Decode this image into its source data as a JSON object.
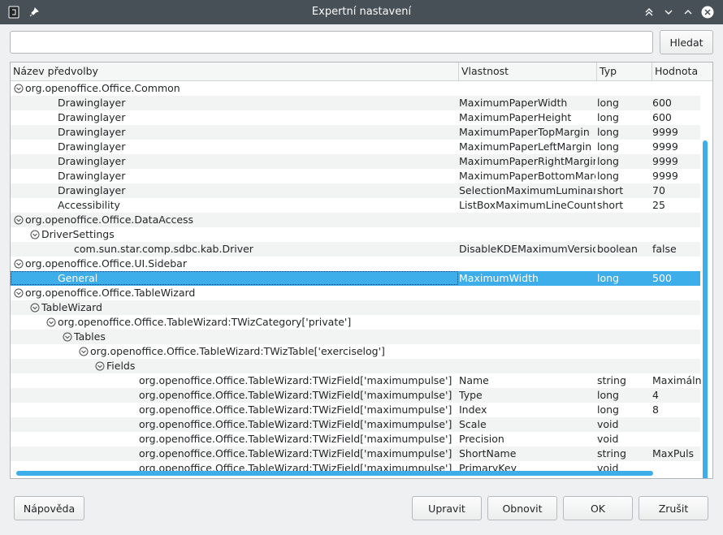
{
  "window": {
    "title": "Expertní nastavení"
  },
  "search": {
    "placeholder": "",
    "value": "",
    "button": "Hledat"
  },
  "columns": [
    "Název předvolby",
    "Vlastnost",
    "Typ",
    "Hodnota"
  ],
  "rows": [
    {
      "level": 0,
      "expander": true,
      "name": "org.openoffice.Office.Common",
      "prop": "",
      "type": "",
      "value": ""
    },
    {
      "level": 1,
      "expander": false,
      "name": "Drawinglayer",
      "prop": "MaximumPaperWidth",
      "type": "long",
      "value": "600"
    },
    {
      "level": 1,
      "expander": false,
      "name": "Drawinglayer",
      "prop": "MaximumPaperHeight",
      "type": "long",
      "value": "600"
    },
    {
      "level": 1,
      "expander": false,
      "name": "Drawinglayer",
      "prop": "MaximumPaperTopMargin",
      "type": "long",
      "value": "9999"
    },
    {
      "level": 1,
      "expander": false,
      "name": "Drawinglayer",
      "prop": "MaximumPaperLeftMargin",
      "type": "long",
      "value": "9999"
    },
    {
      "level": 1,
      "expander": false,
      "name": "Drawinglayer",
      "prop": "MaximumPaperRightMargin",
      "type": "long",
      "value": "9999"
    },
    {
      "level": 1,
      "expander": false,
      "name": "Drawinglayer",
      "prop": "MaximumPaperBottomMargin",
      "type": "long",
      "value": "9999"
    },
    {
      "level": 1,
      "expander": false,
      "name": "Drawinglayer",
      "prop": "SelectionMaximumLuminancePercent",
      "type": "short",
      "value": "70"
    },
    {
      "level": 1,
      "expander": false,
      "name": "Accessibility",
      "prop": "ListBoxMaximumLineCount",
      "type": "short",
      "value": "25"
    },
    {
      "level": 0,
      "expander": true,
      "name": "org.openoffice.Office.DataAccess",
      "prop": "",
      "type": "",
      "value": ""
    },
    {
      "level": 1,
      "expander": true,
      "name": "DriverSettings",
      "prop": "",
      "type": "",
      "value": ""
    },
    {
      "level": 2,
      "expander": false,
      "name": "com.sun.star.comp.sdbc.kab.Driver",
      "prop": "DisableKDEMaximumVersionCheck",
      "type": "boolean",
      "value": "false"
    },
    {
      "level": 0,
      "expander": true,
      "name": "org.openoffice.Office.UI.Sidebar",
      "prop": "",
      "type": "",
      "value": ""
    },
    {
      "level": 1,
      "expander": false,
      "name": "General",
      "prop": "MaximumWidth",
      "type": "long",
      "value": "500",
      "selected": true
    },
    {
      "level": 0,
      "expander": true,
      "name": "org.openoffice.Office.TableWizard",
      "prop": "",
      "type": "",
      "value": ""
    },
    {
      "level": 1,
      "expander": true,
      "name": "TableWizard",
      "prop": "",
      "type": "",
      "value": ""
    },
    {
      "level": 2,
      "expander": true,
      "name": "org.openoffice.Office.TableWizard:TWizCategory['private']",
      "prop": "",
      "type": "",
      "value": ""
    },
    {
      "level": 3,
      "expander": true,
      "name": "Tables",
      "prop": "",
      "type": "",
      "value": ""
    },
    {
      "level": 4,
      "expander": true,
      "name": "org.openoffice.Office.TableWizard:TWizTable['exerciselog']",
      "prop": "",
      "type": "",
      "value": ""
    },
    {
      "level": 5,
      "expander": true,
      "name": "Fields",
      "prop": "",
      "type": "",
      "value": ""
    },
    {
      "level": 6,
      "expander": false,
      "name": "org.openoffice.Office.TableWizard:TWizField['maximumpulse']",
      "prop": "Name",
      "type": "string",
      "value": "Maximální"
    },
    {
      "level": 6,
      "expander": false,
      "name": "org.openoffice.Office.TableWizard:TWizField['maximumpulse']",
      "prop": "Type",
      "type": "long",
      "value": "4"
    },
    {
      "level": 6,
      "expander": false,
      "name": "org.openoffice.Office.TableWizard:TWizField['maximumpulse']",
      "prop": "Index",
      "type": "long",
      "value": "8"
    },
    {
      "level": 6,
      "expander": false,
      "name": "org.openoffice.Office.TableWizard:TWizField['maximumpulse']",
      "prop": "Scale",
      "type": "void",
      "value": ""
    },
    {
      "level": 6,
      "expander": false,
      "name": "org.openoffice.Office.TableWizard:TWizField['maximumpulse']",
      "prop": "Precision",
      "type": "void",
      "value": ""
    },
    {
      "level": 6,
      "expander": false,
      "name": "org.openoffice.Office.TableWizard:TWizField['maximumpulse']",
      "prop": "ShortName",
      "type": "string",
      "value": "MaxPuls"
    },
    {
      "level": 6,
      "expander": false,
      "name": "org.openoffice.Office.TableWizard:TWizField['maximumpulse']",
      "prop": "PrimaryKey",
      "type": "void",
      "value": ""
    }
  ],
  "buttons": {
    "help": "Nápověda",
    "edit": "Upravit",
    "reset": "Obnovit",
    "ok": "OK",
    "cancel": "Zrušit"
  },
  "colors": {
    "accent": "#3daee9",
    "titlebar": "#475057"
  }
}
